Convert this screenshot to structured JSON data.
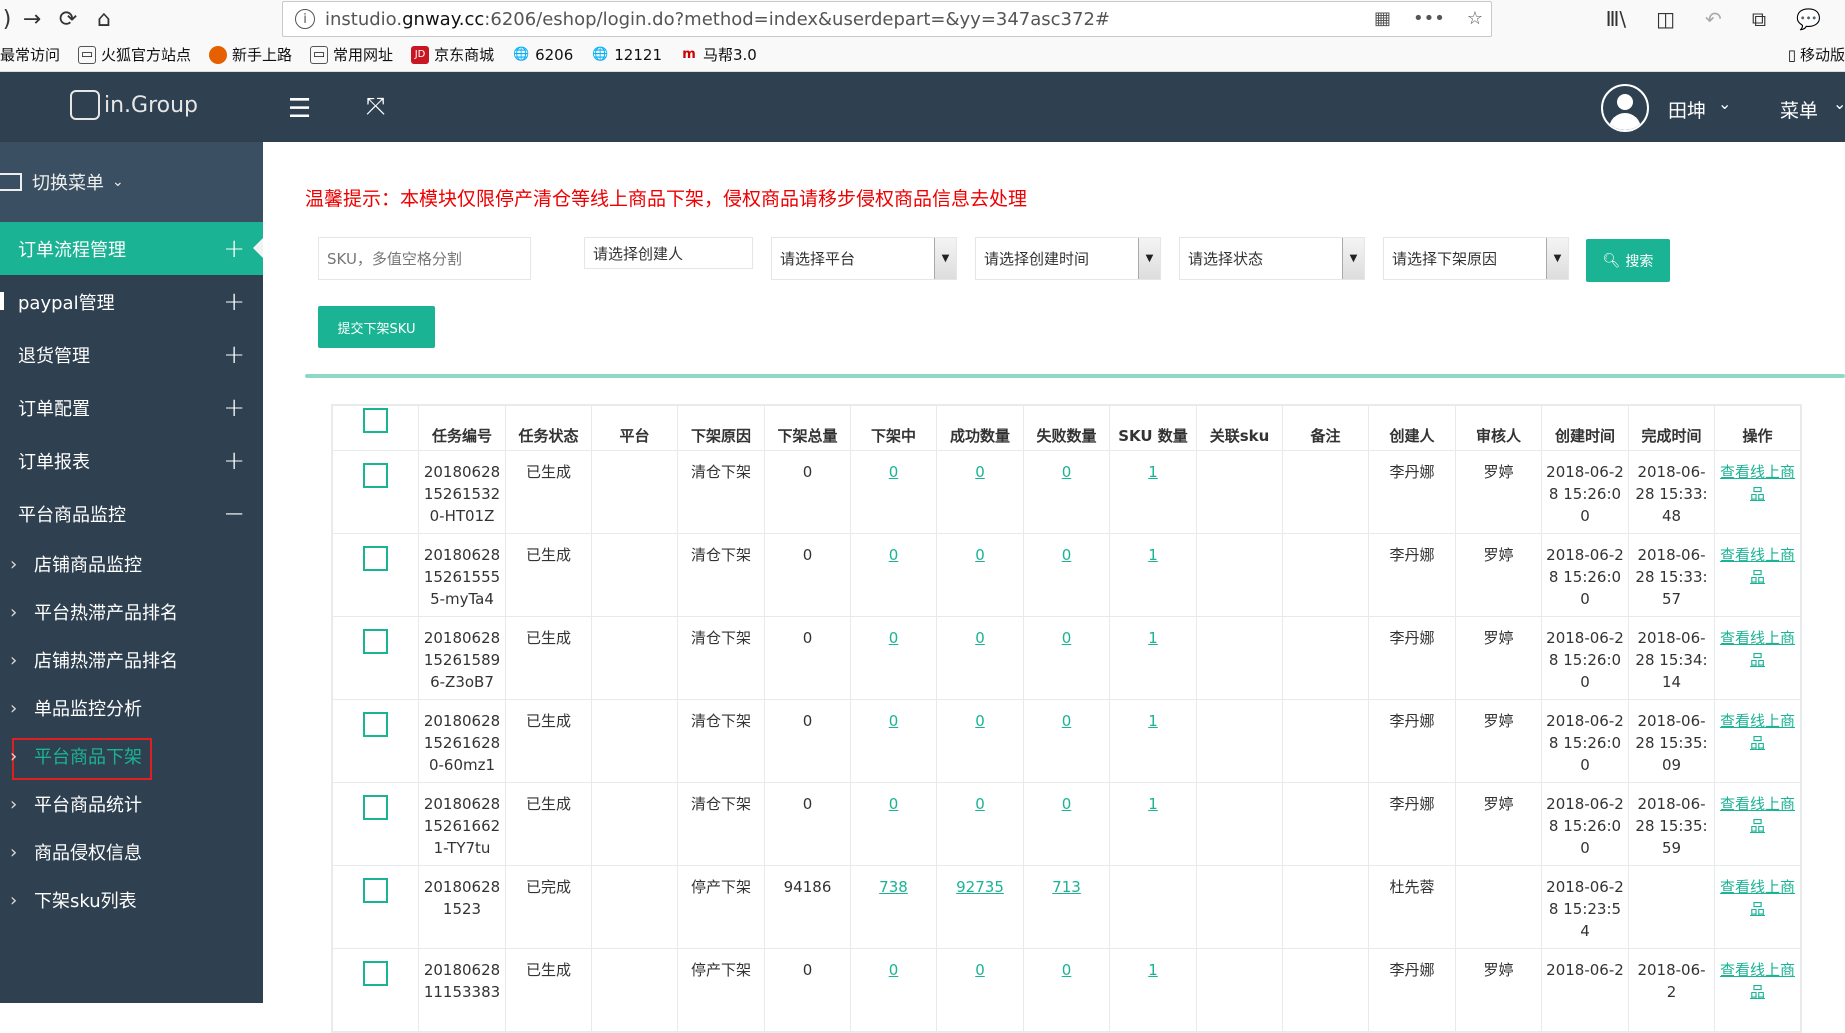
{
  "browser": {
    "url_prefix": "instudio.",
    "url_domain": "gnway.cc",
    "url_rest": ":6206/eshop/login.do?method=index&userdepart=&yy=347asc372#",
    "bookmarks": [
      {
        "label": "最常访问",
        "icon": "gear-icon"
      },
      {
        "label": "火狐官方站点",
        "icon": "folder-icon"
      },
      {
        "label": "新手上路",
        "icon": "firefox-icon"
      },
      {
        "label": "常用网址",
        "icon": "folder-icon"
      },
      {
        "label": "京东商城",
        "icon": "jd-icon"
      },
      {
        "label": "6206",
        "icon": "globe-icon"
      },
      {
        "label": "12121",
        "icon": "globe-icon"
      },
      {
        "label": "马帮3.0",
        "icon": "mabang-icon"
      }
    ],
    "mobile_bookmarks": "移动版"
  },
  "header": {
    "logo_text": "in.Group",
    "user_name": "田坤",
    "menu_label": "菜单"
  },
  "sidebar": {
    "switch_label": "切换菜单",
    "groups": [
      {
        "label": "订单流程管理",
        "toggle": "+"
      },
      {
        "label": "paypal管理",
        "toggle": "+"
      },
      {
        "label": "退货管理",
        "toggle": "+"
      },
      {
        "label": "订单配置",
        "toggle": "+"
      },
      {
        "label": "订单报表",
        "toggle": "+"
      },
      {
        "label": "平台商品监控",
        "toggle": "−"
      }
    ],
    "subitems": [
      "店铺商品监控",
      "平台热滞产品排名",
      "店铺热滞产品排名",
      "单品监控分析",
      "平台商品下架",
      "平台商品统计",
      "商品侵权信息",
      "下架sku列表"
    ]
  },
  "main": {
    "notice": "温馨提示：本模块仅限停产清仓等线上商品下架，侵权商品请移步侵权商品信息去处理",
    "filters": {
      "sku_placeholder": "SKU，多值空格分割",
      "creator": "请选择创建人",
      "platform": "请选择平台",
      "created_time": "请选择创建时间",
      "status": "请选择状态",
      "reason": "请选择下架原因"
    },
    "search_label": "搜索",
    "submit_label": "提交下架SKU"
  },
  "table": {
    "headers": [
      "任务编号",
      "任务状态",
      "平台",
      "下架原因",
      "下架总量",
      "下架中",
      "成功数量",
      "失败数量",
      "SKU 数量",
      "关联sku",
      "备注",
      "创建人",
      "审核人",
      "创建时间",
      "完成时间",
      "操作"
    ],
    "rows": [
      {
        "id": "2018062815261532 0-HT01Z",
        "status": "已生成",
        "platform": "",
        "reason": "清仓下架",
        "total": "0",
        "in_progress": "0",
        "success": "0",
        "failed": "0",
        "sku_count": "1",
        "related": "",
        "note": "",
        "creator": "李丹娜",
        "reviewer": "罗婷",
        "created": "2018-06-28 15:26:00",
        "finished": "2018-06-28 15:33:48",
        "action": "查看线上商品"
      },
      {
        "id": "2018062815261555 5-myTa4",
        "status": "已生成",
        "platform": "",
        "reason": "清仓下架",
        "total": "0",
        "in_progress": "0",
        "success": "0",
        "failed": "0",
        "sku_count": "1",
        "related": "",
        "note": "",
        "creator": "李丹娜",
        "reviewer": "罗婷",
        "created": "2018-06-28 15:26:00",
        "finished": "2018-06-28 15:33:57",
        "action": "查看线上商品"
      },
      {
        "id": "2018062815261589 6-Z3oB7",
        "status": "已生成",
        "platform": "",
        "reason": "清仓下架",
        "total": "0",
        "in_progress": "0",
        "success": "0",
        "failed": "0",
        "sku_count": "1",
        "related": "",
        "note": "",
        "creator": "李丹娜",
        "reviewer": "罗婷",
        "created": "2018-06-28 15:26:00",
        "finished": "2018-06-28 15:34:14",
        "action": "查看线上商品"
      },
      {
        "id": "2018062815261628 0-60mz1",
        "status": "已生成",
        "platform": "",
        "reason": "清仓下架",
        "total": "0",
        "in_progress": "0",
        "success": "0",
        "failed": "0",
        "sku_count": "1",
        "related": "",
        "note": "",
        "creator": "李丹娜",
        "reviewer": "罗婷",
        "created": "2018-06-28 15:26:00",
        "finished": "2018-06-28 15:35:09",
        "action": "查看线上商品"
      },
      {
        "id": "2018062815261662 1-TY7tu",
        "status": "已生成",
        "platform": "",
        "reason": "清仓下架",
        "total": "0",
        "in_progress": "0",
        "success": "0",
        "failed": "0",
        "sku_count": "1",
        "related": "",
        "note": "",
        "creator": "李丹娜",
        "reviewer": "罗婷",
        "created": "2018-06-28 15:26:00",
        "finished": "2018-06-28 15:35:59",
        "action": "查看线上商品"
      },
      {
        "id": "201806281523",
        "status": "已完成",
        "platform": "",
        "reason": "停产下架",
        "total": "94186",
        "in_progress": "738",
        "success": "92735",
        "failed": "713",
        "sku_count": "",
        "related": "",
        "note": "",
        "creator": "杜先蓉",
        "reviewer": "",
        "created": "2018-06-28 15:23:54",
        "finished": "",
        "action": "查看线上商品"
      },
      {
        "id": "2018062811153383",
        "status": "已生成",
        "platform": "",
        "reason": "停产下架",
        "total": "0",
        "in_progress": "0",
        "success": "0",
        "failed": "0",
        "sku_count": "1",
        "related": "",
        "note": "",
        "creator": "李丹娜",
        "reviewer": "罗婷",
        "created": "2018-06-2",
        "finished": "2018-06-2",
        "action": "查看线上商品"
      }
    ]
  }
}
